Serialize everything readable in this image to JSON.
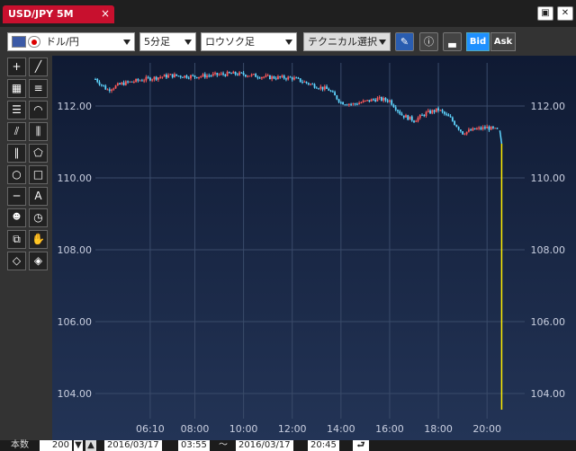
{
  "tab": {
    "title": "USD/JPY 5M",
    "close": "×"
  },
  "window_buttons": [
    "▣",
    "✕"
  ],
  "toolbar": {
    "currency": "ドル/円",
    "interval": "5分足",
    "chart_style": "ロウソク足",
    "technical": "テクニカル選択",
    "bid": "Bid",
    "ask": "Ask"
  },
  "bottom": {
    "label": "本数",
    "count": "200",
    "from_date": "2016/03/17",
    "from_time": "03:55",
    "tilde": "～",
    "to_date": "2016/03/17",
    "to_time": "20:45"
  },
  "chart_data": {
    "type": "candlestick",
    "ylim": [
      103.3,
      113.2
    ],
    "y_ticks": [
      "112.00",
      "110.00",
      "108.00",
      "106.00",
      "104.00"
    ],
    "y_tick_values": [
      112,
      110,
      108,
      106,
      104
    ],
    "x_ticks": [
      "06:10",
      "08:00",
      "10:00",
      "12:00",
      "14:00",
      "16:00",
      "18:00",
      "20:00"
    ],
    "x_tick_hours": [
      6.1667,
      8,
      10,
      12,
      14,
      16,
      18,
      20
    ],
    "x_range_hours": [
      3.9167,
      21.25
    ],
    "anchor_hours": [
      3.9167,
      4.4,
      5.0,
      6.0,
      7.0,
      8.0,
      9.5,
      10.0,
      11.0,
      12.0,
      13.0,
      13.5,
      14.0,
      14.5,
      15.5,
      16.0,
      16.5,
      17.0,
      17.5,
      18.0,
      18.5,
      19.0,
      19.5,
      20.0,
      20.45
    ],
    "anchor_prices": [
      112.75,
      112.45,
      112.62,
      112.75,
      112.85,
      112.82,
      112.9,
      112.88,
      112.8,
      112.78,
      112.55,
      112.45,
      112.1,
      112.05,
      112.2,
      112.15,
      111.75,
      111.6,
      111.8,
      111.9,
      111.65,
      111.25,
      111.35,
      111.4,
      111.32
    ],
    "spike": {
      "hour": 20.6,
      "high": 110.95,
      "low": 103.55
    },
    "colors": {
      "up": "#ff5a5a",
      "down": "#5fd6ff",
      "spike": "#ffee00",
      "grid": "#3a4b6a",
      "background_top": "#0f1a33",
      "background_bottom": "#233456",
      "axis_text": "#c9cfe0"
    }
  }
}
